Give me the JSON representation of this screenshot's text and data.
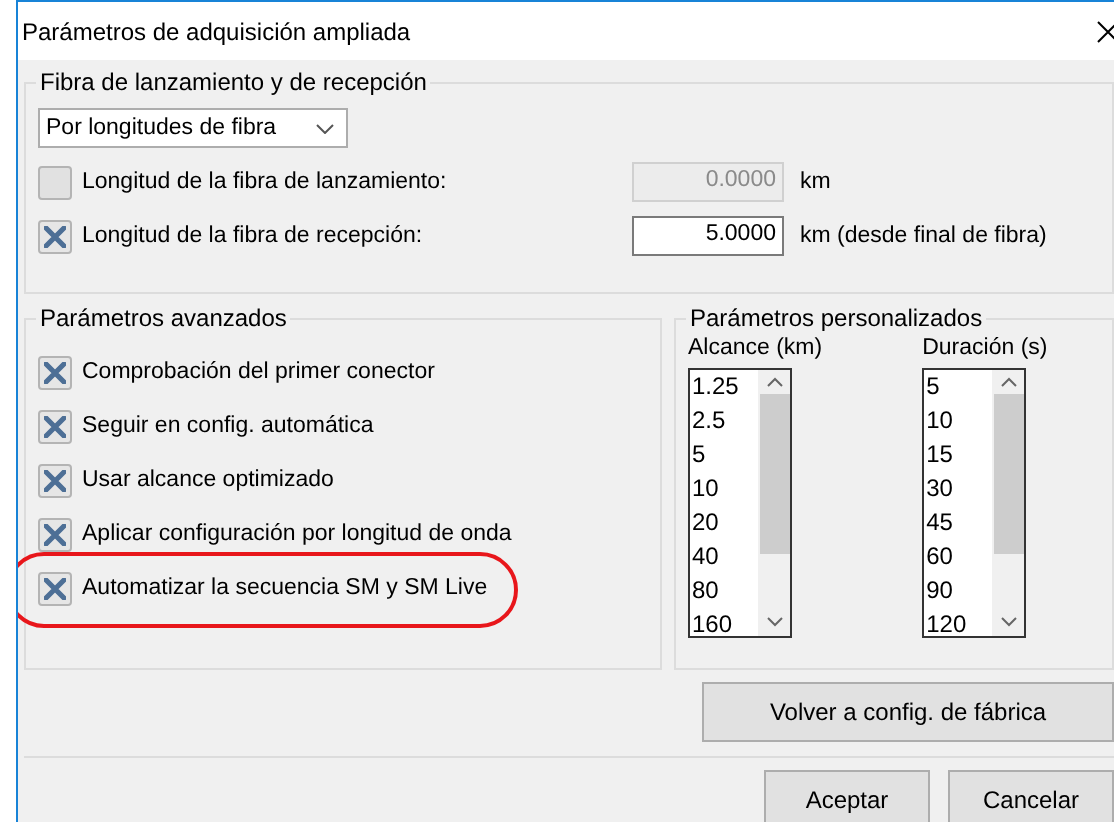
{
  "window": {
    "title": "Parámetros de adquisición ampliada"
  },
  "fiber_group": {
    "title": "Fibra de lanzamiento y de recepción",
    "mode": "Por longitudes de fibra",
    "rows": [
      {
        "label": "Longitud de la fibra de lanzamiento:",
        "checked": false,
        "value": "0.0000",
        "unit": "km"
      },
      {
        "label": "Longitud de la fibra de recepción:",
        "checked": true,
        "value": "5.0000",
        "unit": "km (desde final de fibra)"
      }
    ]
  },
  "advanced_group": {
    "title": "Parámetros avanzados",
    "items": [
      {
        "label": "Comprobación del primer conector",
        "checked": true,
        "highlighted": false
      },
      {
        "label": "Seguir en config. automática",
        "checked": true,
        "highlighted": false
      },
      {
        "label": "Usar alcance optimizado",
        "checked": true,
        "highlighted": false
      },
      {
        "label": "Aplicar configuración por longitud de onda",
        "checked": true,
        "highlighted": false
      },
      {
        "label": "Automatizar la secuencia SM y SM Live",
        "checked": true,
        "highlighted": true
      }
    ]
  },
  "custom_group": {
    "title": "Parámetros personalizados",
    "lists": [
      {
        "label": "Alcance (km)",
        "items": [
          "1.25",
          "2.5",
          "5",
          "10",
          "20",
          "40",
          "80",
          "160"
        ]
      },
      {
        "label": "Duración (s)",
        "items": [
          "5",
          "10",
          "15",
          "30",
          "45",
          "60",
          "90",
          "120"
        ]
      }
    ],
    "reset_button": "Volver a config. de fábrica"
  },
  "buttons": [
    "Aceptar",
    "Cancelar"
  ]
}
